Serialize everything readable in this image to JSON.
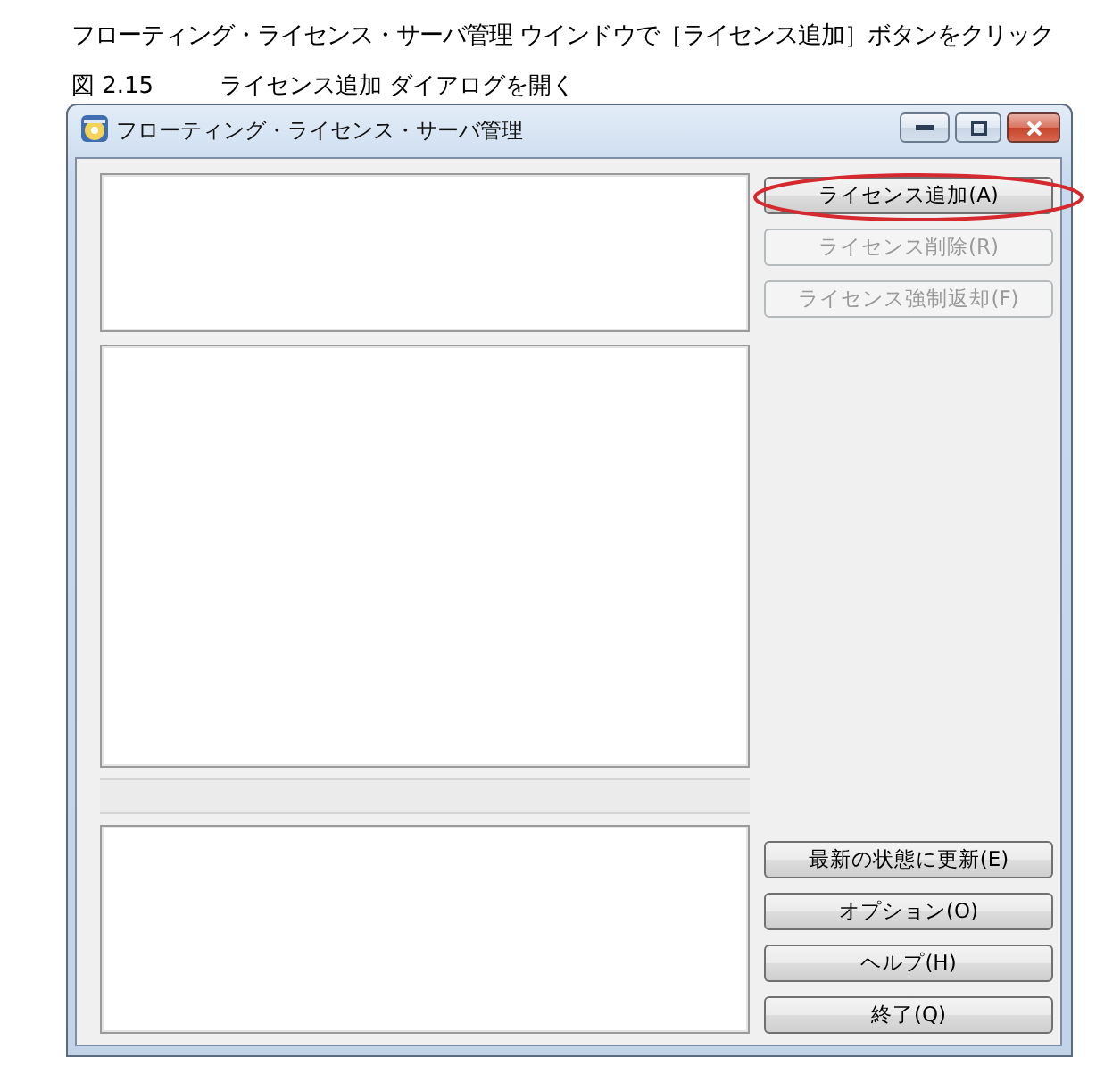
{
  "instruction": "フローティング・ライセンス・サーバ管理 ウインドウで［ライセンス追加］ボタンをクリック",
  "figure": {
    "number": "図 2.15",
    "caption": "ライセンス追加 ダイアログを開く"
  },
  "window": {
    "title": "フローティング・ライセンス・サーバ管理",
    "top_buttons": [
      {
        "label": "ライセンス追加(A)",
        "disabled": false,
        "highlighted": true
      },
      {
        "label": "ライセンス削除(R)",
        "disabled": true,
        "highlighted": false
      },
      {
        "label": "ライセンス強制返却(F)",
        "disabled": true,
        "highlighted": false
      }
    ],
    "bottom_buttons": [
      {
        "label": "最新の状態に更新(E)",
        "disabled": false,
        "highlighted": false
      },
      {
        "label": "オプション(O)",
        "disabled": false,
        "highlighted": false
      },
      {
        "label": "ヘルプ(H)",
        "disabled": false,
        "highlighted": false
      },
      {
        "label": "終了(Q)",
        "disabled": false,
        "highlighted": false
      }
    ]
  }
}
